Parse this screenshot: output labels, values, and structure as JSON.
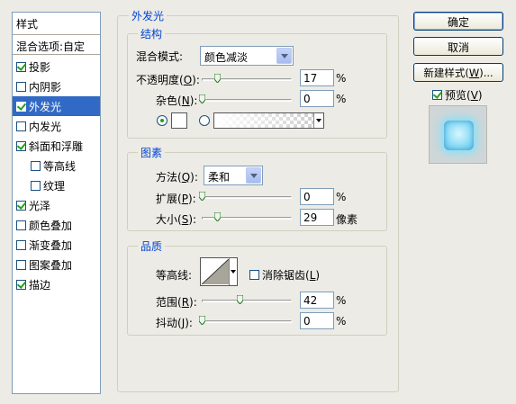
{
  "left_panel": {
    "header": "样式",
    "blend_options": "混合选项:自定",
    "items": [
      {
        "label": "投影",
        "checked": true
      },
      {
        "label": "内阴影",
        "checked": false
      },
      {
        "label": "外发光",
        "checked": true
      },
      {
        "label": "内发光",
        "checked": false
      },
      {
        "label": "斜面和浮雕",
        "checked": true
      },
      {
        "label": "等高线",
        "checked": false
      },
      {
        "label": "纹理",
        "checked": false
      },
      {
        "label": "光泽",
        "checked": true
      },
      {
        "label": "颜色叠加",
        "checked": false
      },
      {
        "label": "渐变叠加",
        "checked": false
      },
      {
        "label": "图案叠加",
        "checked": false
      },
      {
        "label": "描边",
        "checked": true
      }
    ]
  },
  "main": {
    "title": "外发光",
    "structure": {
      "title": "结构",
      "blend_mode_label": "混合模式:",
      "blend_mode_value": "颜色减淡",
      "opacity_label": "不透明度",
      "opacity_key": "O",
      "opacity_value": "17",
      "opacity_unit": "%",
      "opacity_fraction": 0.17,
      "noise_label": "杂色",
      "noise_key": "N",
      "noise_value": "0",
      "noise_unit": "%",
      "noise_fraction": 0.0,
      "color_radio_selected": "solid"
    },
    "elements": {
      "title": "图素",
      "technique_label": "方法",
      "technique_key": "Q",
      "technique_value": "柔和",
      "spread_label": "扩展",
      "spread_key": "P",
      "spread_value": "0",
      "spread_unit": "%",
      "spread_fraction": 0.0,
      "size_label": "大小",
      "size_key": "S",
      "size_value": "29",
      "size_unit": "像素",
      "size_fraction": 0.12
    },
    "quality": {
      "title": "品质",
      "contour_label": "等高线:",
      "anti_alias_label": "消除锯齿",
      "anti_alias_key": "L",
      "anti_alias_checked": false,
      "range_label": "范围",
      "range_key": "R",
      "range_value": "42",
      "range_unit": "%",
      "range_fraction": 0.42,
      "jitter_label": "抖动",
      "jitter_key": "J",
      "jitter_value": "0",
      "jitter_unit": "%",
      "jitter_fraction": 0.0
    }
  },
  "right_panel": {
    "ok": "确定",
    "cancel": "取消",
    "new_style": "新建样式",
    "new_style_key": "W",
    "preview_label": "预览",
    "preview_key": "V",
    "preview_checked": true
  },
  "colors": {
    "selection": "#316ac5",
    "group_title": "#0046d5",
    "dialog_bg": "#ecebe6",
    "glow": "#8ee0f5"
  }
}
